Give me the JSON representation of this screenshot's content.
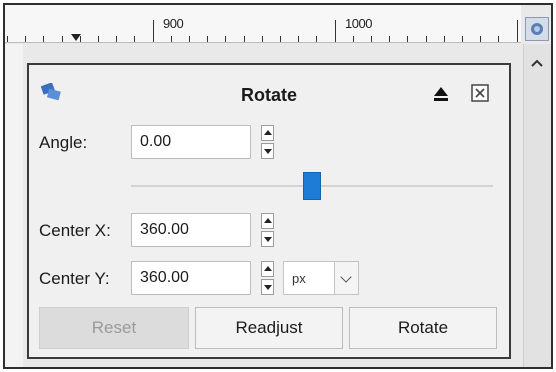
{
  "ruler": {
    "label_900": "900",
    "label_1000": "1000"
  },
  "dialog": {
    "title": "Rotate",
    "angle": {
      "label": "Angle:",
      "value": "0.00"
    },
    "angle_slider_position": 0.5,
    "center_x": {
      "label": "Center X:",
      "value": "360.00"
    },
    "center_y": {
      "label": "Center Y:",
      "value": "360.00"
    },
    "unit": {
      "selected": "px"
    },
    "buttons": {
      "reset": "Reset",
      "readjust": "Readjust",
      "rotate": "Rotate"
    }
  },
  "icons": {
    "tool": "rotate-tool-icon",
    "eject": "eject-icon",
    "close": "close-icon",
    "navigate": "navigate-icon",
    "scroll_up": "scroll-up-icon"
  },
  "colors": {
    "accent": "#1f7cd6",
    "dialog_bg": "#f0f0f0",
    "disabled_button": "#dcdcdc"
  }
}
